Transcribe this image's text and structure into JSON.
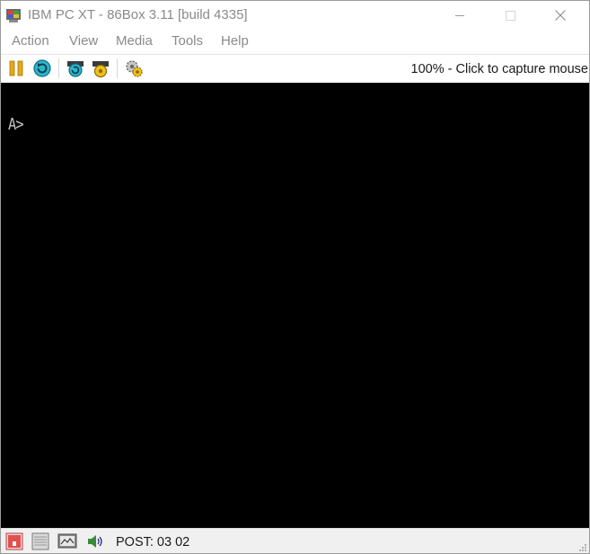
{
  "window": {
    "title": "IBM PC XT - 86Box 3.11 [build 4335]",
    "icon": "86box-app-icon"
  },
  "titlebar_buttons": {
    "minimize_icon": "minimize-icon",
    "maximize_icon": "maximize-icon",
    "close_icon": "close-icon",
    "close_glyph": "✕"
  },
  "menu": {
    "items": [
      "Action",
      "View",
      "Media",
      "Tools",
      "Help"
    ]
  },
  "toolbar": {
    "buttons": [
      {
        "name": "pause",
        "icon": "pause-icon",
        "color": "#e6a817"
      },
      {
        "name": "reset",
        "icon": "reset-icon",
        "color": "#1aa0b8"
      },
      {
        "name": "hard-reset",
        "icon": "hard-reset-icon",
        "color": "#1aa0b8"
      },
      {
        "name": "ctrl-alt-del",
        "icon": "ctrl-alt-del-icon",
        "color": "#d9a400"
      },
      {
        "name": "settings",
        "icon": "settings-gear-icon",
        "color": "#b0b0b0"
      }
    ],
    "status_message": "100% - Click to capture mouse"
  },
  "screen": {
    "background": "#000000",
    "text_color": "#c8c8c8",
    "prompt": "A>"
  },
  "statusbar": {
    "icons": [
      {
        "name": "cassette",
        "icon": "cassette-icon",
        "color": "#e05050"
      },
      {
        "name": "floppy",
        "icon": "floppy-icon"
      },
      {
        "name": "display",
        "icon": "display-adapter-icon"
      },
      {
        "name": "sound",
        "icon": "sound-icon"
      }
    ],
    "post_text": "POST: 03 02"
  }
}
